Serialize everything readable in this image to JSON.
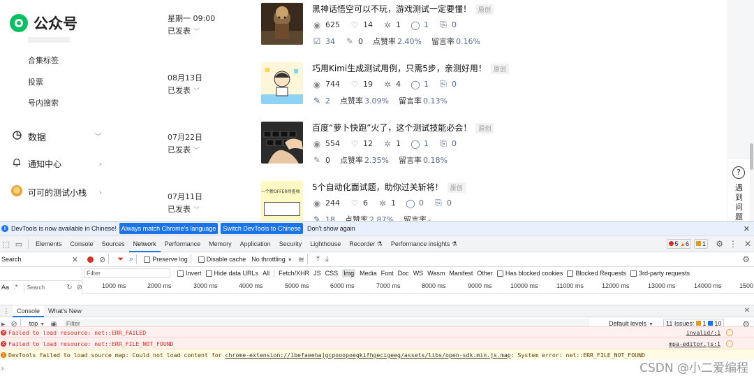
{
  "sidebar": {
    "logo_text": "公众号",
    "sub_items": [
      "合集标签",
      "投票",
      "号内搜索"
    ],
    "menu": [
      {
        "label": "数据",
        "icon": "data-icon"
      },
      {
        "label": "通知中心",
        "icon": "bell-icon"
      },
      {
        "label": "可可的测试小栈",
        "icon": "avatar"
      }
    ]
  },
  "articles": [
    {
      "date": "星期一 09:00",
      "status": "已发表",
      "title": "黑神话悟空可以不玩，游戏测试一定要懂！",
      "tag": "原创",
      "views": "625",
      "likes": "14",
      "shares": "1",
      "comments": "1",
      "forwards": "0",
      "row2_icon": "check-icon",
      "row2_val": "34",
      "edits": "0",
      "like_rate_label": "点赞率",
      "like_rate": "2.40%",
      "comment_rate_label": "留言率",
      "comment_rate": "0.16%"
    },
    {
      "date": "08月13日",
      "status": "已发表",
      "title": "巧用Kimi生成测试用例，只需5步，亲测好用！",
      "tag": "原创",
      "views": "744",
      "likes": "19",
      "shares": "4",
      "comments": "1",
      "forwards": "0",
      "row2_icon": "edit-icon",
      "row2_val": "2",
      "like_rate_label": "点赞率",
      "like_rate": "3.09%",
      "comment_rate_label": "留言率",
      "comment_rate": "0.13%"
    },
    {
      "date": "07月22日",
      "status": "已发表",
      "title": "百度“萝卜快跑”火了，这个测试技能必会！",
      "tag": "原创",
      "views": "554",
      "likes": "12",
      "shares": "1",
      "comments": "1",
      "forwards": "0",
      "row2_icon": "edit-icon",
      "row2_val": "0",
      "like_rate_label": "点赞率",
      "like_rate": "2.35%",
      "comment_rate_label": "留言率",
      "comment_rate": "0.18%"
    },
    {
      "date": "07月11日",
      "status": "已发表",
      "title": "5个自动化面试题，助你过关斩将！",
      "tag": "原创",
      "views": "244",
      "likes": "6",
      "shares": "1",
      "comments": "0",
      "forwards": "0",
      "row2_icon": "edit-icon",
      "row2_val": "18",
      "like_rate_label": "点赞率",
      "like_rate": "2.87%",
      "comment_rate_label": "留言率",
      "comment_rate": "-"
    }
  ],
  "thumb4_text": "一个新OFFER待查收",
  "help": {
    "text": "遇到问题"
  },
  "devtools": {
    "info_text": "DevTools is now available in Chinese!",
    "btn_match": "Always match Chrome's language",
    "btn_switch": "Switch DevTools to Chinese",
    "btn_dismiss": "Don't show again",
    "tabs": [
      "Elements",
      "Console",
      "Sources",
      "Network",
      "Performance",
      "Memory",
      "Application",
      "Security",
      "Lighthouse",
      "Recorder",
      "Performance insights"
    ],
    "active_tab": "Network",
    "errors_count": "5",
    "warnings_count": "6",
    "info_count": "1",
    "preserve_log": "Preserve log",
    "disable_cache": "Disable cache",
    "throttling": "No throttling",
    "search_label": "Search",
    "filter_placeholder": "Filter",
    "invert": "Invert",
    "hide_data_urls": "Hide data URLs",
    "type_filters": [
      "All",
      "Fetch/XHR",
      "JS",
      "CSS",
      "Img",
      "Media",
      "Font",
      "Doc",
      "WS",
      "Wasm",
      "Manifest",
      "Other"
    ],
    "active_type": "Img",
    "blocked_cookies": "Has blocked cookies",
    "blocked_requests": "Blocked Requests",
    "third_party": "3rd-party requests",
    "aa": "Aa",
    "search_placeholder": "Search",
    "timeline": [
      "1000 ms",
      "2000 ms",
      "3000 ms",
      "4000 ms",
      "5000 ms",
      "6000 ms",
      "7000 ms",
      "8000 ms",
      "9000 ms",
      "10000 ms",
      "11000 ms",
      "12000 ms",
      "13000 ms",
      "14000 ms",
      "1500"
    ],
    "drawer_tabs": [
      "Console",
      "What's New"
    ],
    "context": "top",
    "console_filter": "Filter",
    "levels": "Default levels",
    "issues_label": "11 Issues:",
    "issues_warn": "1",
    "issues_info": "10",
    "logs": [
      {
        "kind": "err",
        "text": "Failed to load resource: net::ERR_FAILED",
        "src": "invalid/:1"
      },
      {
        "kind": "err",
        "text": "Failed to load resource: net::ERR_FILE_NOT_FOUND",
        "src": "mpa-editor.js:1"
      },
      {
        "kind": "warn",
        "count": "2",
        "text_pre": "DevTools failed to load source map: Could not load content for ",
        "link": "chrome-extension://ibefaeehajgcpooopoegkifhgecigeeg/assets/libs/open-sdk.min.js.map",
        "text_post": ": System error: net::ERR_FILE_NOT_FOUND"
      }
    ],
    "prompt": "›"
  },
  "watermark": "CSDN @小二爱编程"
}
